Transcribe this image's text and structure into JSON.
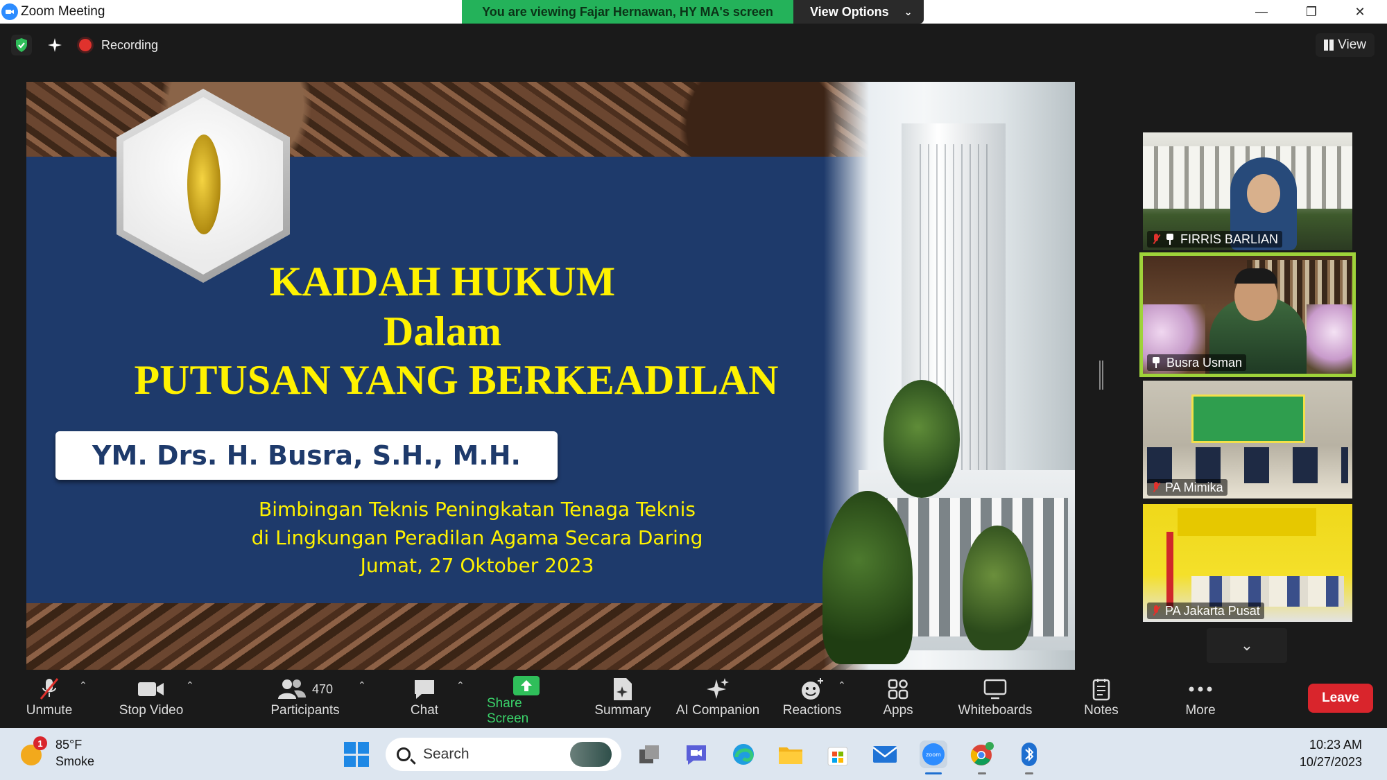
{
  "window": {
    "title": "Zoom Meeting",
    "sharing_banner": "You are viewing Fajar Hernawan, HY MA's screen",
    "view_options_label": "View Options"
  },
  "topbar": {
    "recording_label": "Recording",
    "view_label": "View"
  },
  "slide": {
    "title_line1": "KAIDAH HUKUM",
    "title_line2": "Dalam",
    "title_line3": "PUTUSAN YANG BERKEADILAN",
    "speaker": "YM. Drs. H. Busra, S.H., M.H.",
    "subtitle_line1": "Bimbingan Teknis Peningkatan Tenaga Teknis",
    "subtitle_line2": "di Lingkungan Peradilan Agama Secara Daring",
    "subtitle_line3": "Jumat,  27 Oktober 2023"
  },
  "participants": [
    {
      "name": "FIRRIS BARLIAN",
      "muted": true,
      "pinned": true,
      "active": false
    },
    {
      "name": "Busra Usman",
      "muted": false,
      "pinned": true,
      "active": true
    },
    {
      "name": "PA Mimika",
      "muted": true,
      "pinned": false,
      "active": false
    },
    {
      "name": "PA Jakarta Pusat",
      "muted": true,
      "pinned": false,
      "active": false
    }
  ],
  "toolbar": {
    "unmute": "Unmute",
    "stop_video": "Stop Video",
    "participants": "Participants",
    "participants_count": "470",
    "chat": "Chat",
    "share_screen": "Share Screen",
    "summary": "Summary",
    "ai_companion": "AI Companion",
    "reactions": "Reactions",
    "apps": "Apps",
    "whiteboards": "Whiteboards",
    "notes": "Notes",
    "more": "More",
    "leave": "Leave"
  },
  "taskbar": {
    "weather_temp": "85°F",
    "weather_desc": "Smoke",
    "weather_badge": "1",
    "search_placeholder": "Search",
    "time": "10:23 AM",
    "date": "10/27/2023",
    "zoom_icon_text": "zoom"
  },
  "colors": {
    "accent_green": "#24b25a",
    "leave_red": "#d9252c",
    "slide_blue": "#1e3a6b",
    "slide_yellow": "#fff200",
    "active_speaker": "#9fd33a"
  }
}
